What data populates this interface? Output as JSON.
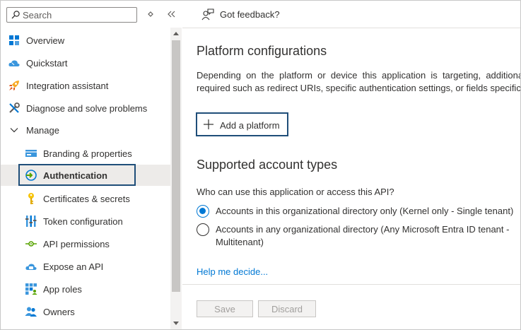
{
  "sidebar": {
    "search_placeholder": "Search",
    "items": [
      {
        "label": "Overview",
        "icon": "overview-grid-icon"
      },
      {
        "label": "Quickstart",
        "icon": "quickstart-cloud-icon"
      },
      {
        "label": "Integration assistant",
        "icon": "rocket-icon"
      },
      {
        "label": "Diagnose and solve problems",
        "icon": "wrench-icon"
      },
      {
        "label": "Manage",
        "icon": "chevron-down-icon"
      },
      {
        "label": "Branding & properties",
        "icon": "branding-card-icon"
      },
      {
        "label": "Authentication",
        "icon": "authentication-icon",
        "selected": true
      },
      {
        "label": "Certificates & secrets",
        "icon": "key-icon"
      },
      {
        "label": "Token configuration",
        "icon": "token-bars-icon"
      },
      {
        "label": "API permissions",
        "icon": "api-permissions-icon"
      },
      {
        "label": "Expose an API",
        "icon": "expose-api-cloud-icon"
      },
      {
        "label": "App roles",
        "icon": "app-roles-grid-icon"
      },
      {
        "label": "Owners",
        "icon": "owners-people-icon"
      }
    ]
  },
  "header": {
    "feedback_label": "Got feedback?"
  },
  "platform": {
    "title": "Platform configurations",
    "description": "Depending on the platform or device this application is targeting, additional configuration may be required such as redirect URIs, specific authentication settings, or fields specific to the platform.",
    "add_button": "Add a platform"
  },
  "accounts": {
    "title": "Supported account types",
    "question": "Who can use this application or access this API?",
    "options": [
      {
        "label": "Accounts in this organizational directory only (Kernel only - Single tenant)",
        "checked": true
      },
      {
        "label": "Accounts in any organizational directory (Any Microsoft Entra ID tenant - Multitenant)",
        "checked": false
      }
    ],
    "help_link": "Help me decide..."
  },
  "footer": {
    "save_label": "Save",
    "discard_label": "Discard"
  },
  "colors": {
    "accent": "#0078d4",
    "focus": "#1f4e79",
    "selected_bg": "#edebe9"
  }
}
